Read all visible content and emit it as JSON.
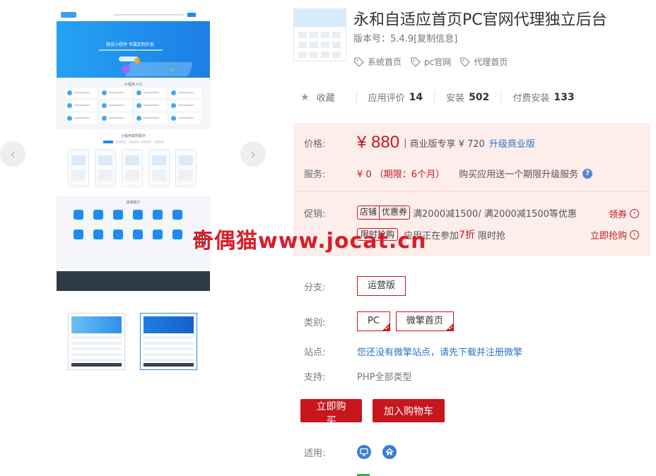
{
  "product": {
    "title": "永和自适应首页PC官网代理独立后台",
    "version": "版本号：5.4.9[复制信息]",
    "tags": [
      "系统首页",
      "pc官网",
      "代理首页"
    ]
  },
  "gallery": {
    "hero_text": "微信小程序 专属定制开发",
    "section1": "小程序入口",
    "section2": "小程序案例展示",
    "section3": "适用客户",
    "prev": "‹",
    "next": "›"
  },
  "stats": {
    "favorite_label": "收藏",
    "rating_label": "应用评价",
    "rating_value": "14",
    "installs_label": "安装",
    "installs_value": "502",
    "paid_label": "付费安装",
    "paid_value": "133"
  },
  "pricing": {
    "price_label": "价格:",
    "price": "¥ 880",
    "separator": "|",
    "commercial_text": "商业版专享 ¥ 720",
    "upgrade_link": "升级商业版",
    "service_label": "服务:",
    "service_value": "¥ 0 （期限：6个月）",
    "service_note": "购买应用送一个期限升级服务",
    "help": "?",
    "promo_label": "促销:",
    "promo_badge_a": "店铺",
    "promo_badge_b": "优惠券",
    "promo_text": "满2000减1500/ 满2000减1500等优惠",
    "promo_action": "领券",
    "flash_badge": "限时抢购",
    "flash_text_a": "应用正在参加",
    "flash_discount": "7折",
    "flash_text_b": "限时抢",
    "flash_action": "立即抢购",
    "arrow": "›"
  },
  "watermark": "奇偶猫www.jocat.cn",
  "attributes": {
    "branch_label": "分支:",
    "branch_option": "运营版",
    "category_label": "类别:",
    "category_options": [
      "PC",
      "微擎首页"
    ],
    "site_label": "站点:",
    "site_value": "您还没有微擎站点，请先下载并注册微擎",
    "support_label": "支持:",
    "support_value": "PHP全部类型",
    "applies_label": "适用:"
  },
  "buttons": {
    "buy": "立即购买",
    "cart": "加入购物车"
  },
  "colors": {
    "brand_red": "#c8161d",
    "link_blue": "#2a73c9",
    "price_bg": "#fdeeeb"
  }
}
